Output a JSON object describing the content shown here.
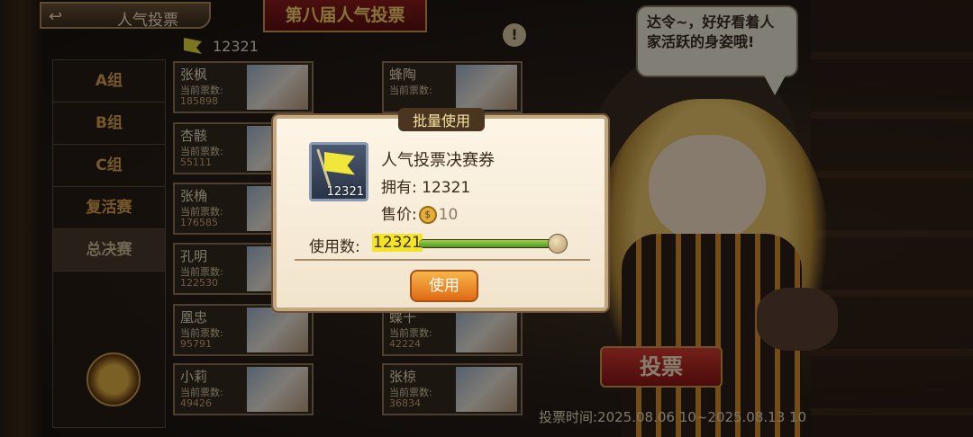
{
  "header": {
    "title": "人气投票",
    "banner": "第八届人气投票",
    "notice_icon": "!"
  },
  "speech": "达令~，好好看着人家活跃的身姿哦!",
  "vote_tickets": "12321",
  "sidebar": {
    "items": [
      {
        "label": "A组"
      },
      {
        "label": "B组"
      },
      {
        "label": "C组"
      },
      {
        "label": "复活赛"
      },
      {
        "label": "总决赛"
      }
    ]
  },
  "cards_label": "当前票数:",
  "cards": [
    {
      "name": "张枫",
      "votes": "185898"
    },
    {
      "name": "蜂陶",
      "votes": ""
    },
    {
      "name": "杏骸",
      "votes": "55111"
    },
    {
      "name": "张桷",
      "votes": "176585"
    },
    {
      "name": "孔明",
      "votes": "122530"
    },
    {
      "name": "凰忠",
      "votes": "95791"
    },
    {
      "name": "蝶千",
      "votes": "42224"
    },
    {
      "name": "小莉",
      "votes": "49426"
    },
    {
      "name": "张椋",
      "votes": "36834"
    }
  ],
  "vote_button": "投票",
  "vote_time": "投票时间:2025.08.06 10~2025.08.13 10",
  "dialog": {
    "title": "批量使用",
    "item_name": "人气投票决赛券",
    "item_qty": "12321",
    "own_label": "拥有: 12321",
    "price_label": "售价:",
    "price_value": "10",
    "coin_glyph": "$",
    "qty_label": "使用数:",
    "qty_value": "12321",
    "qty_max": 12321,
    "slider_fraction": 1.0,
    "use_button": "使用"
  },
  "colors": {
    "accent_red": "#8a1c1c",
    "slider_green": "#6ab832",
    "use_button_orange": "#f08a20"
  }
}
